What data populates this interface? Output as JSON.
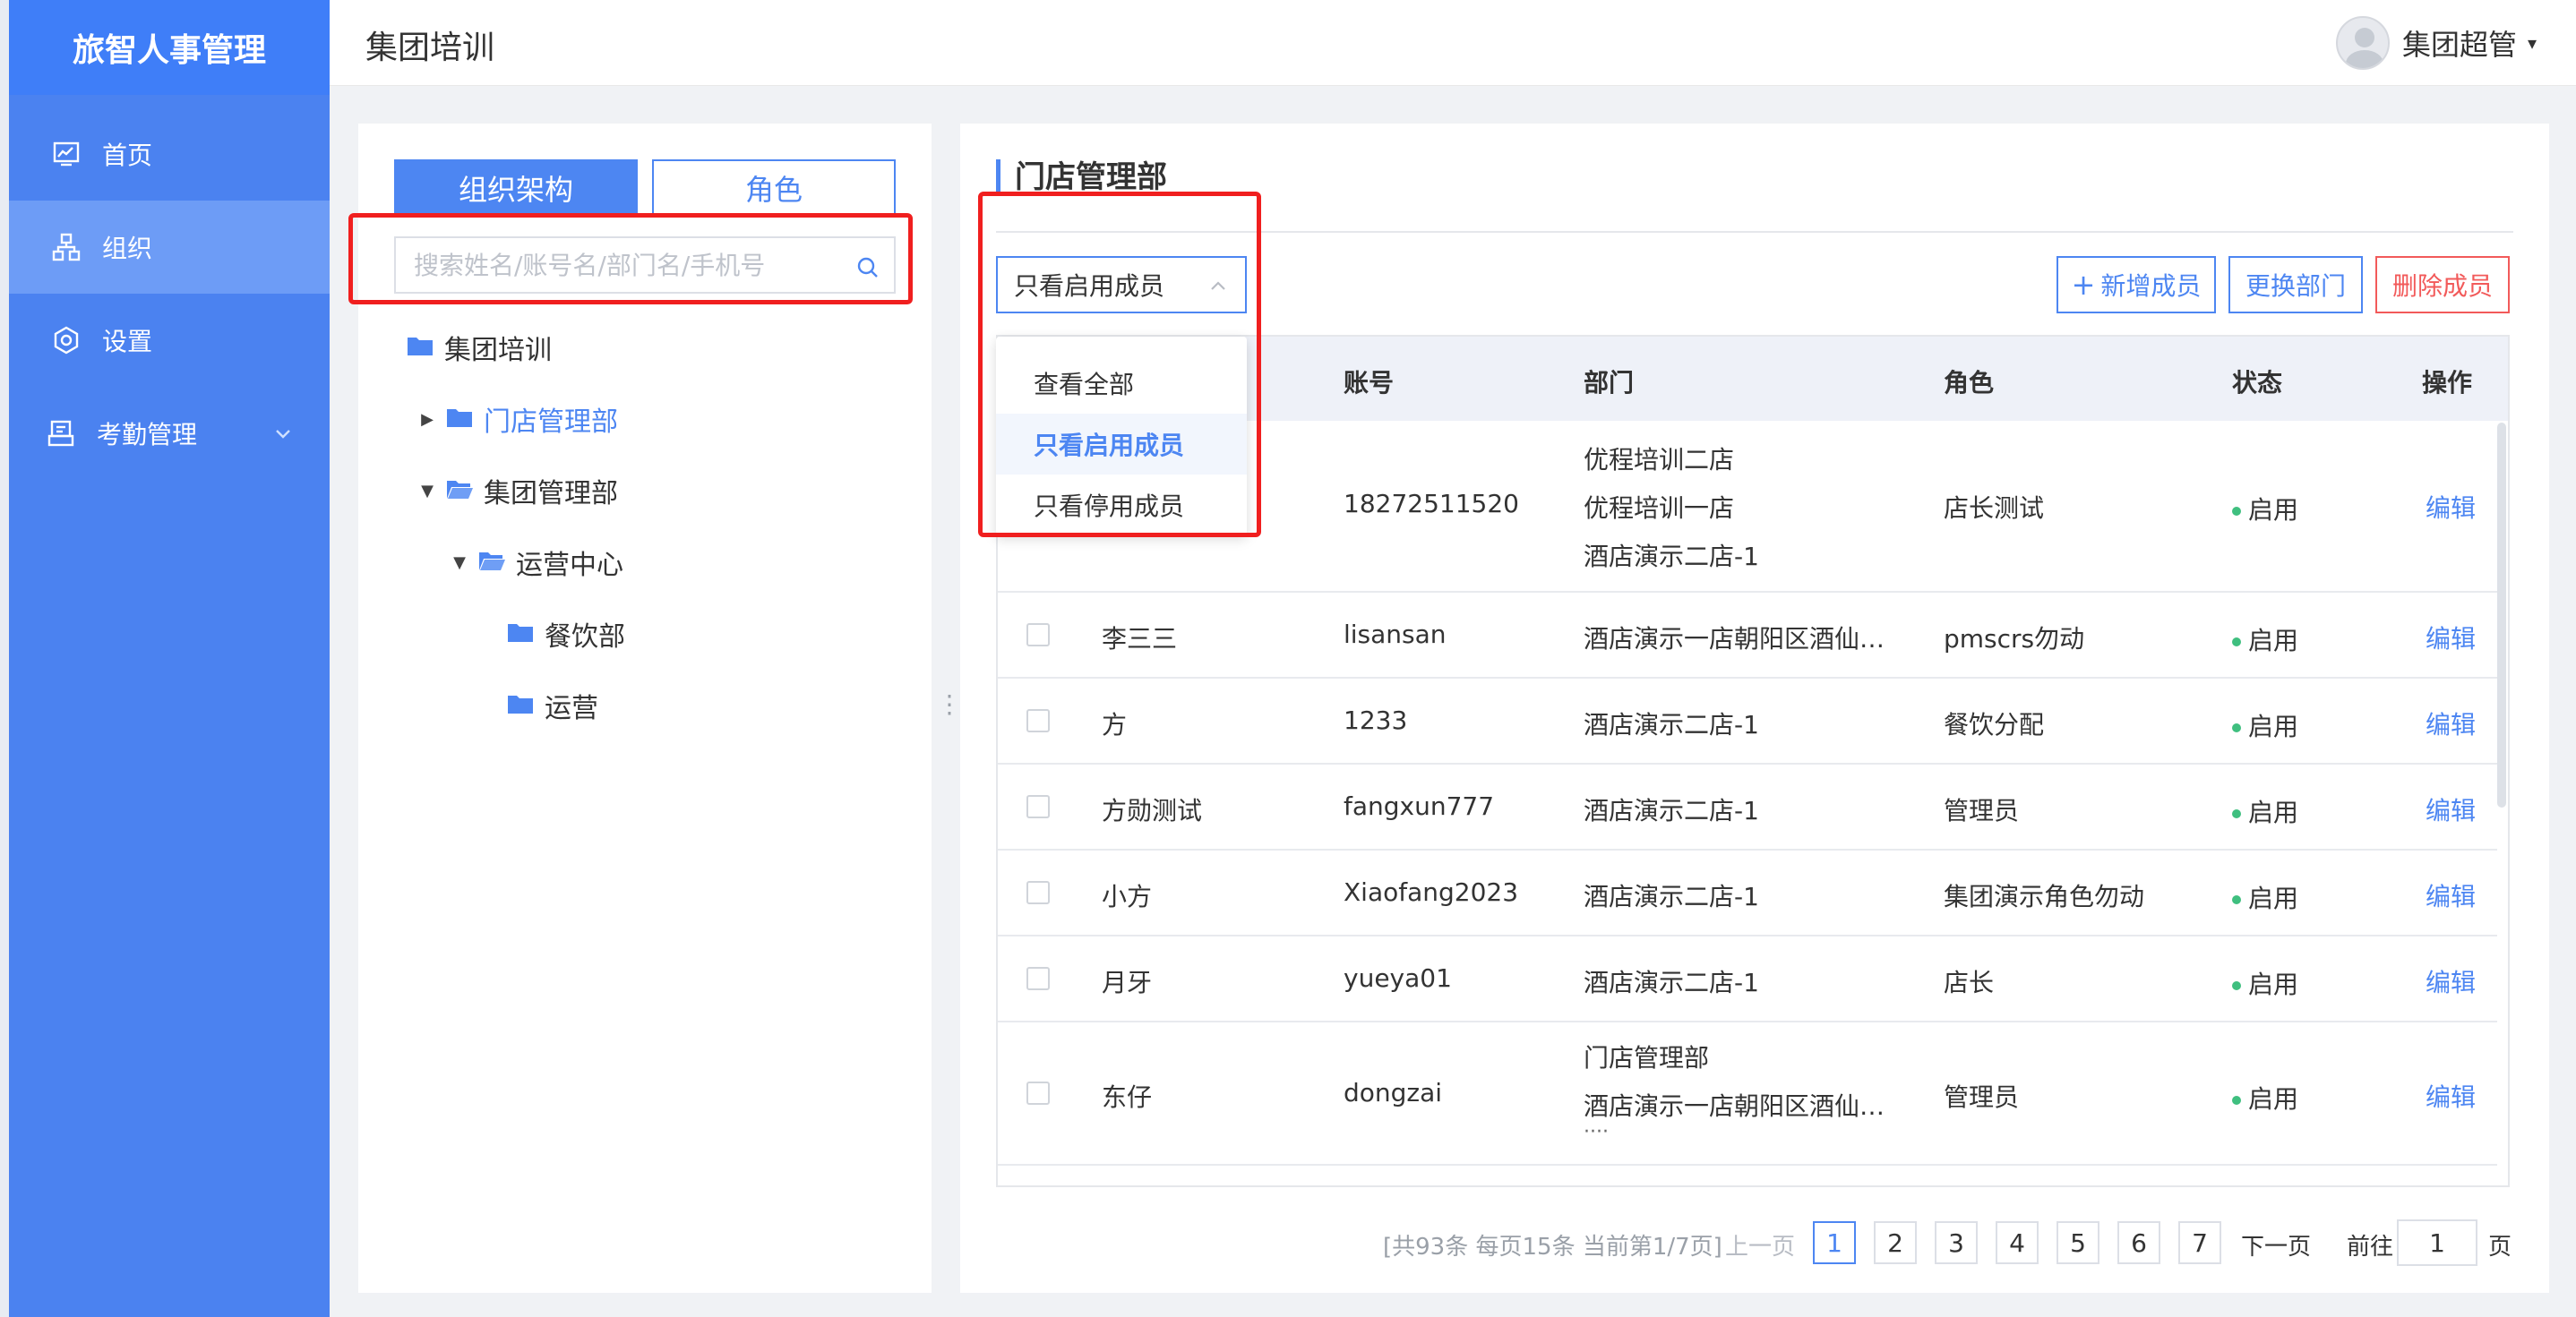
{
  "app": {
    "brand": "旅智人事管理"
  },
  "sidebar": {
    "items": [
      {
        "label": "首页",
        "icon": "chart-icon"
      },
      {
        "label": "组织",
        "icon": "org-icon"
      },
      {
        "label": "设置",
        "icon": "gear-icon"
      },
      {
        "label": "考勤管理",
        "icon": "attendance-icon"
      }
    ]
  },
  "header": {
    "title": "集团培训",
    "user": "集团超管"
  },
  "left_panel": {
    "tabs": [
      "组织架构",
      "角色"
    ],
    "search_placeholder": "搜索姓名/账号名/部门名/手机号",
    "tree": [
      {
        "label": "集团培训"
      },
      {
        "label": "门店管理部"
      },
      {
        "label": "集团管理部"
      },
      {
        "label": "运营中心"
      },
      {
        "label": "餐饮部"
      },
      {
        "label": "运营"
      }
    ]
  },
  "right_panel": {
    "dept_title": "门店管理部",
    "filter": {
      "selected": "只看启用成员",
      "options": [
        "查看全部",
        "只看启用成员",
        "只看停用成员"
      ]
    },
    "buttons": {
      "add": "新增成员",
      "move": "更换部门",
      "delete": "删除成员"
    },
    "columns": [
      "账号",
      "部门",
      "角色",
      "状态",
      "操作"
    ],
    "rows": [
      {
        "name": "",
        "account": "18272511520",
        "dept": [
          "优程培训二店",
          "优程培训一店",
          "酒店演示二店-1"
        ],
        "role": "店长测试",
        "status": "启用",
        "action": "编辑"
      },
      {
        "name": "李三三",
        "account": "lisansan",
        "dept": [
          "酒店演示一店朝阳区酒仙…"
        ],
        "role": "pmscrs勿动",
        "status": "启用",
        "action": "编辑"
      },
      {
        "name": "方",
        "account": "1233",
        "dept": [
          "酒店演示二店-1"
        ],
        "role": "餐饮分配",
        "status": "启用",
        "action": "编辑"
      },
      {
        "name": "方勋测试",
        "account": "fangxun777",
        "dept": [
          "酒店演示二店-1"
        ],
        "role": "管理员",
        "status": "启用",
        "action": "编辑"
      },
      {
        "name": "小方",
        "account": "Xiaofang2023",
        "dept": [
          "酒店演示二店-1"
        ],
        "role": "集团演示角色勿动",
        "status": "启用",
        "action": "编辑"
      },
      {
        "name": "月牙",
        "account": "yueya01",
        "dept": [
          "酒店演示二店-1"
        ],
        "role": "店长",
        "status": "启用",
        "action": "编辑"
      },
      {
        "name": "东仔",
        "account": "dongzai",
        "dept": [
          "门店管理部",
          "酒店演示一店朝阳区酒仙…",
          "····"
        ],
        "role": "管理员",
        "status": "启用",
        "action": "编辑"
      }
    ],
    "pagination": {
      "summary": "[共93条 每页15条 当前第1/7页]",
      "prev": "上一页",
      "pages": [
        "1",
        "2",
        "3",
        "4",
        "5",
        "6",
        "7"
      ],
      "next": "下一页",
      "goto_label": "前往",
      "goto_value": "1",
      "page_unit": "页"
    }
  },
  "colors": {
    "primary": "#4d86f2",
    "danger": "#f25a5a",
    "sidebar": "#4b82f0",
    "highlight_box": "#f01f1f",
    "status_ok": "#3fbf7f"
  }
}
